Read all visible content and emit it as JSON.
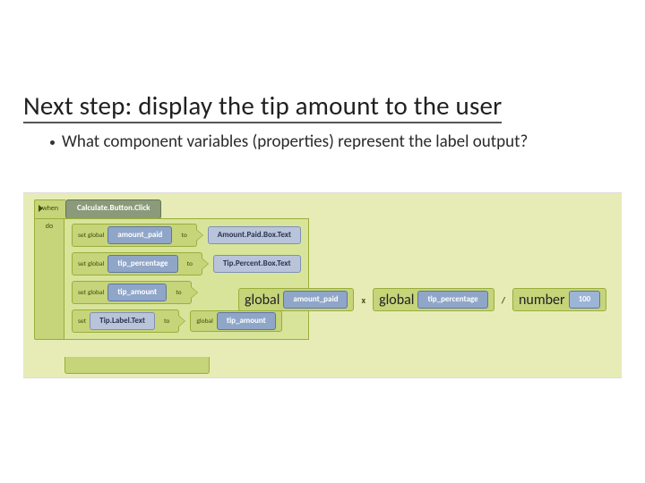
{
  "title": "Next step: display the tip amount to the user",
  "bullet": "What component variables (properties) represent the label output?",
  "when_kw": "when",
  "do_kw": "do",
  "event": "Calculate.Button.Click",
  "set_global": "set global",
  "set_kw": "set",
  "to_kw": "to",
  "global_kw": "global",
  "number_kw": "number",
  "vars": {
    "amount_paid": "amount_paid",
    "tip_percentage": "tip_percentage",
    "tip_amount": "tip_amount",
    "tip_label_text": "Tip.Label.Text"
  },
  "comps": {
    "amount_paid_box": "Amount.Paid.Box.Text",
    "tip_percent_box": "Tip.Percent.Box.Text"
  },
  "ops": {
    "mul": "x",
    "div": "/"
  },
  "hundred": "100"
}
